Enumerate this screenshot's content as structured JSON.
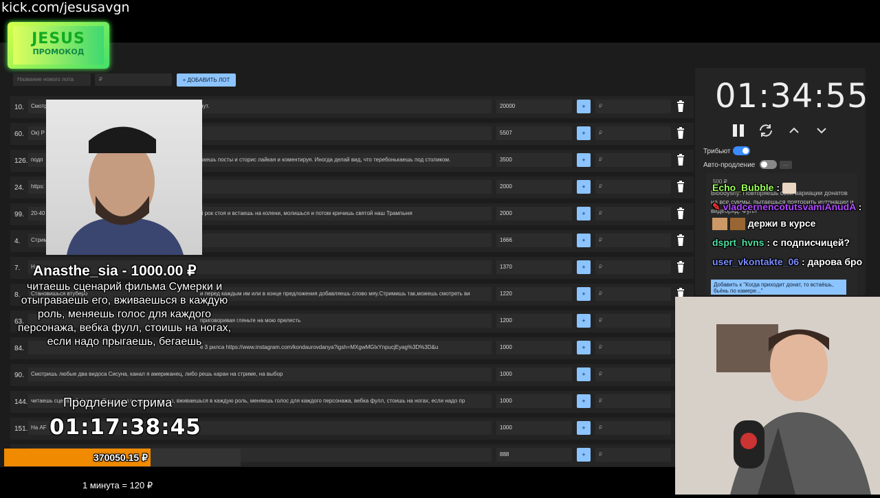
{
  "url": "kick.com/jesusavgn",
  "promo": {
    "title": "JESUS",
    "subtitle": "ПРОМОКОД"
  },
  "new_lot": {
    "name_placeholder": "Название нового лота",
    "price_placeholder": "₽",
    "add_button": "+ ДОБАВИТЬ ЛОТ"
  },
  "lots": [
    {
      "num": "10.",
      "desc": "Смотр",
      "tail": "нут.",
      "amount": "20000"
    },
    {
      "num": "60.",
      "desc": "Ок) Р",
      "tail": "",
      "amount": "5507"
    },
    {
      "num": "126.",
      "desc": "подп",
      "tail": "ваешь посты и сторис лайкая и коментируя. Иногда делай вид, что теребонькаешь под столиком.",
      "amount": "3500"
    },
    {
      "num": "24.",
      "desc": "https:",
      "tail": "",
      "amount": "2000"
    },
    {
      "num": "99.",
      "desc": "20-40",
      "tail": "й рок стоя и встаешь на колени, молишься и потом кричишь святой наш Трампыня",
      "amount": "2000"
    },
    {
      "num": "4.",
      "desc": "Стрим",
      "tail": "",
      "amount": "1666"
    },
    {
      "num": "7.",
      "desc": "На",
      "tail": "",
      "amount": "1370"
    },
    {
      "num": "8.",
      "desc": "Становишься втуберо",
      "tail": "и перед каждым им или в конце предложения добавляешь слово мяу.Стримишь так,можешь смотреть ви",
      "amount": "1220"
    },
    {
      "num": "63.",
      "desc": "",
      "tail": "приговоривая гляньте на мою прелесть",
      "amount": "1200"
    },
    {
      "num": "84.",
      "desc": "",
      "tail": "е 3 рилса https://www.instagram.com/kondaurovdanya?igsh=MXgwMGlxYnpucjEyag%3D%3D&u",
      "amount": "1000"
    },
    {
      "num": "90.",
      "desc": "Смотришь любые два видоса Сисуна, канал я американец, либо решь каран на стриме, на выбор",
      "tail": "",
      "amount": "1000"
    },
    {
      "num": "144.",
      "desc": "читаешь сценарий фильма Сумерки и отыграваешь его, вживаешься в каждую роль, меняешь голос для каждого персонажа, вебка фулл, стоишь на ногах, если надо пр",
      "tail": "",
      "amount": "1000"
    },
    {
      "num": "151.",
      "desc": "На AF",
      "tail": "",
      "amount": "1000"
    },
    {
      "num": "",
      "desc": "",
      "tail": "",
      "amount": "888"
    }
  ],
  "row_plus": "+",
  "row_rub": "₽",
  "timer": {
    "value": "01:34:55"
  },
  "toggles": {
    "tribute": "Трибьют",
    "auto_extend": "Авто-продление"
  },
  "donation": {
    "donor": "Anasthe_sia - 1000.00 ₽",
    "message": "читаешь сценарий фильма Сумерки и отыграваешь его, вживаешься в каждую роль, меняешь голос для каждого персонажа, вебка фулл, стоишь на ногах, если надо прыгаешь, бегаешь"
  },
  "extension": {
    "label": "Продление стрима",
    "clock": "01:17:38:45"
  },
  "progress": {
    "value": "370050.15 ₽",
    "fill_fraction": 0.62
  },
  "rate": "1 минута = 120 ₽",
  "panel_bg": {
    "amount": "500 ₽",
    "bg_text1": "Bloodyshy: Повторяешь свои вариации донатов на все суммы, пытаешься повторить интонации и видеоряд. Фулл",
    "add_btn": "Добавить к \"Когда приходит донат, то встаёшь, бьёнь по камере...\""
  },
  "chat": [
    {
      "user": "Echo_Bubble",
      "text": "",
      "color": "#9dff5c"
    },
    {
      "user": "vladcernencotutsvamiAnudA",
      "text": "",
      "color": "#b04cff"
    },
    {
      "user": "",
      "text": "держи в курсе",
      "color": "#ffffff"
    },
    {
      "user": "dsprt_hvns",
      "text": "с подписчицей?",
      "color": "#4de0a0"
    },
    {
      "user": "user_vkontakte_06",
      "text": "дарова бро",
      "color": "#7a8cff"
    }
  ]
}
